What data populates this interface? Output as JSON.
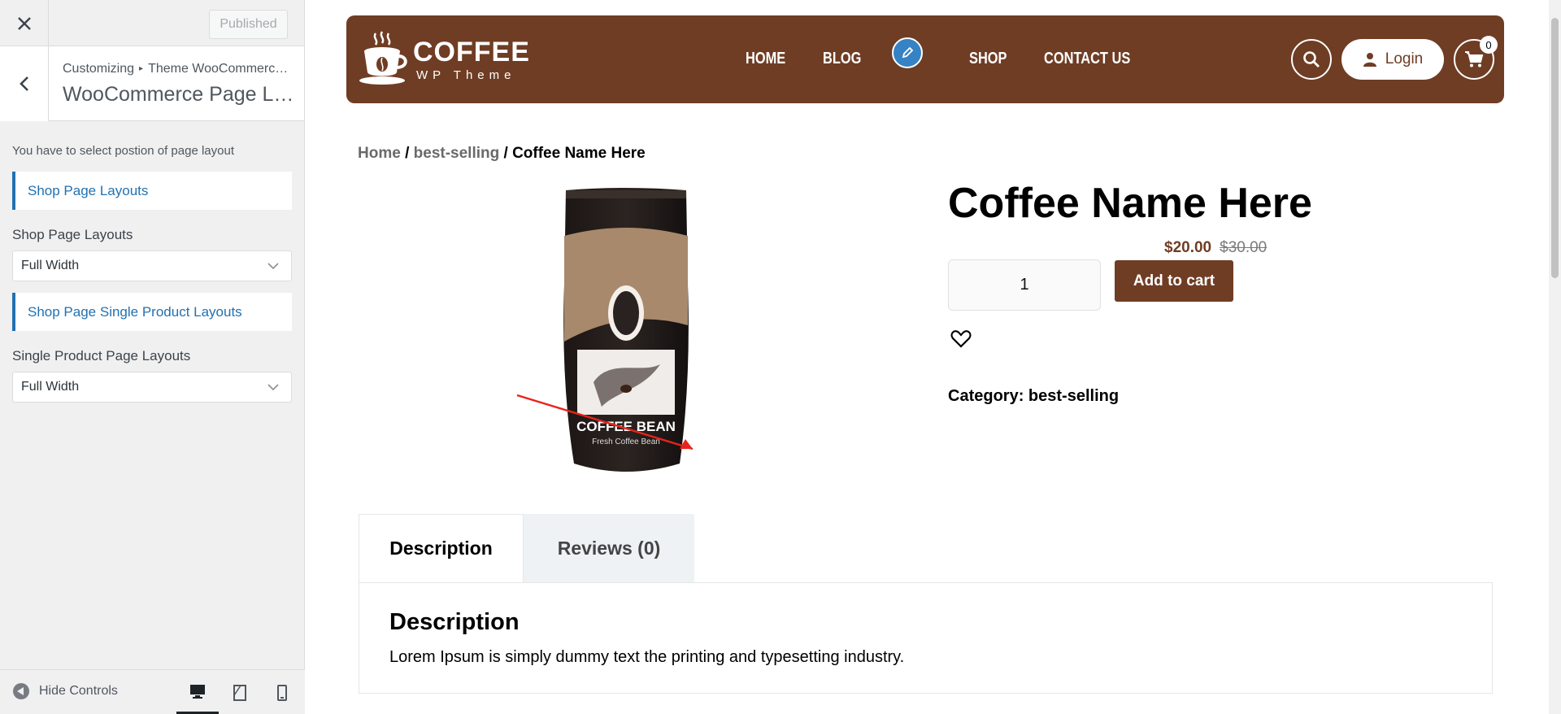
{
  "customizer": {
    "publish_label": "Published",
    "breadcrumb_root": "Customizing",
    "breadcrumb_separator": "▸",
    "breadcrumb_section": "Theme WooCommerce Settings",
    "panel_title": "WooCommerce Page Layout",
    "description": "You have to select postion of page layout",
    "section_shop": "Shop Page Layouts",
    "label_shop": "Shop Page Layouts",
    "select_shop": "Full Width",
    "section_single": "Shop Page Single Product Layouts",
    "label_single": "Single Product Page Layouts",
    "select_single": "Full Width",
    "hide_controls": "Hide Controls",
    "devices": [
      "desktop-icon",
      "tablet-icon",
      "mobile-icon"
    ],
    "active_device": "desktop"
  },
  "site": {
    "logo_main": "COFFEE",
    "logo_sub": "WP Theme",
    "nav": [
      "HOME",
      "BLOG",
      "SHOP",
      "CONTACT US"
    ],
    "login_label": "Login",
    "cart_count": "0",
    "brand_color": "#6f3d24"
  },
  "breadcrumb": {
    "home": "Home",
    "sep1": " / ",
    "category": "best-selling",
    "sep2": " / ",
    "current": "Coffee Name Here"
  },
  "product": {
    "title": "Coffee Name Here",
    "price_now": "$20.00",
    "price_old": "$30.00",
    "quantity": "1",
    "add_to_cart": "Add to cart",
    "category_label": "Category:",
    "category_value": "best-selling",
    "bag_label": "COFFEE BEAN",
    "bag_sub": "Fresh Coffee Bean"
  },
  "tabs": {
    "description_tab": "Description",
    "reviews_tab": "Reviews (0)",
    "panel_title": "Description",
    "panel_text": "Lorem Ipsum is simply dummy text the printing and typesetting industry."
  }
}
